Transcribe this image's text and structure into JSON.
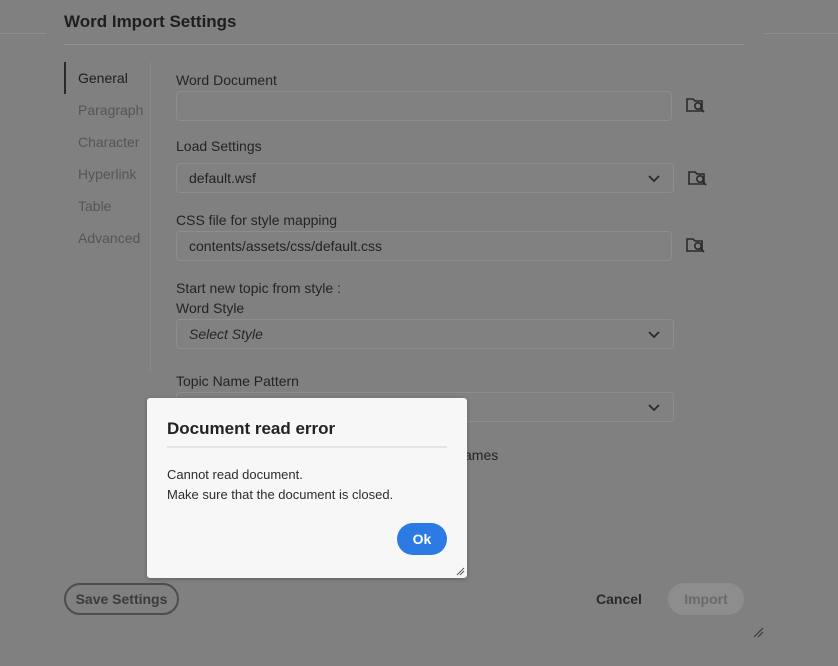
{
  "dialog": {
    "title": "Word Import Settings"
  },
  "nav": {
    "items": [
      {
        "label": "General",
        "active": true
      },
      {
        "label": "Paragraph",
        "active": false
      },
      {
        "label": "Character",
        "active": false
      },
      {
        "label": "Hyperlink",
        "active": false
      },
      {
        "label": "Table",
        "active": false
      },
      {
        "label": "Advanced",
        "active": false
      }
    ]
  },
  "form": {
    "word_document": {
      "label": "Word Document",
      "value": "",
      "icon": "folder-search-icon"
    },
    "load_settings": {
      "label": "Load Settings",
      "value": "default.wsf",
      "icon": "folder-search-icon"
    },
    "css_file": {
      "label": "CSS file for style mapping",
      "value": "contents/assets/css/default.css",
      "icon": "folder-search-icon"
    },
    "new_topic_heading": "Start new topic from style :",
    "word_style": {
      "label": "Word Style",
      "value": "Select Style"
    },
    "topic_name_pattern": {
      "label": "Topic Name Pattern",
      "value": ""
    },
    "checkbox_label_tail": "ames"
  },
  "footer": {
    "save_settings": "Save Settings",
    "cancel": "Cancel",
    "import": "Import"
  },
  "modal": {
    "title": "Document read error",
    "line1": "Cannot read document.",
    "line2": "Make sure that the document is closed.",
    "ok": "Ok",
    "ok_color": "#2c7be5"
  }
}
